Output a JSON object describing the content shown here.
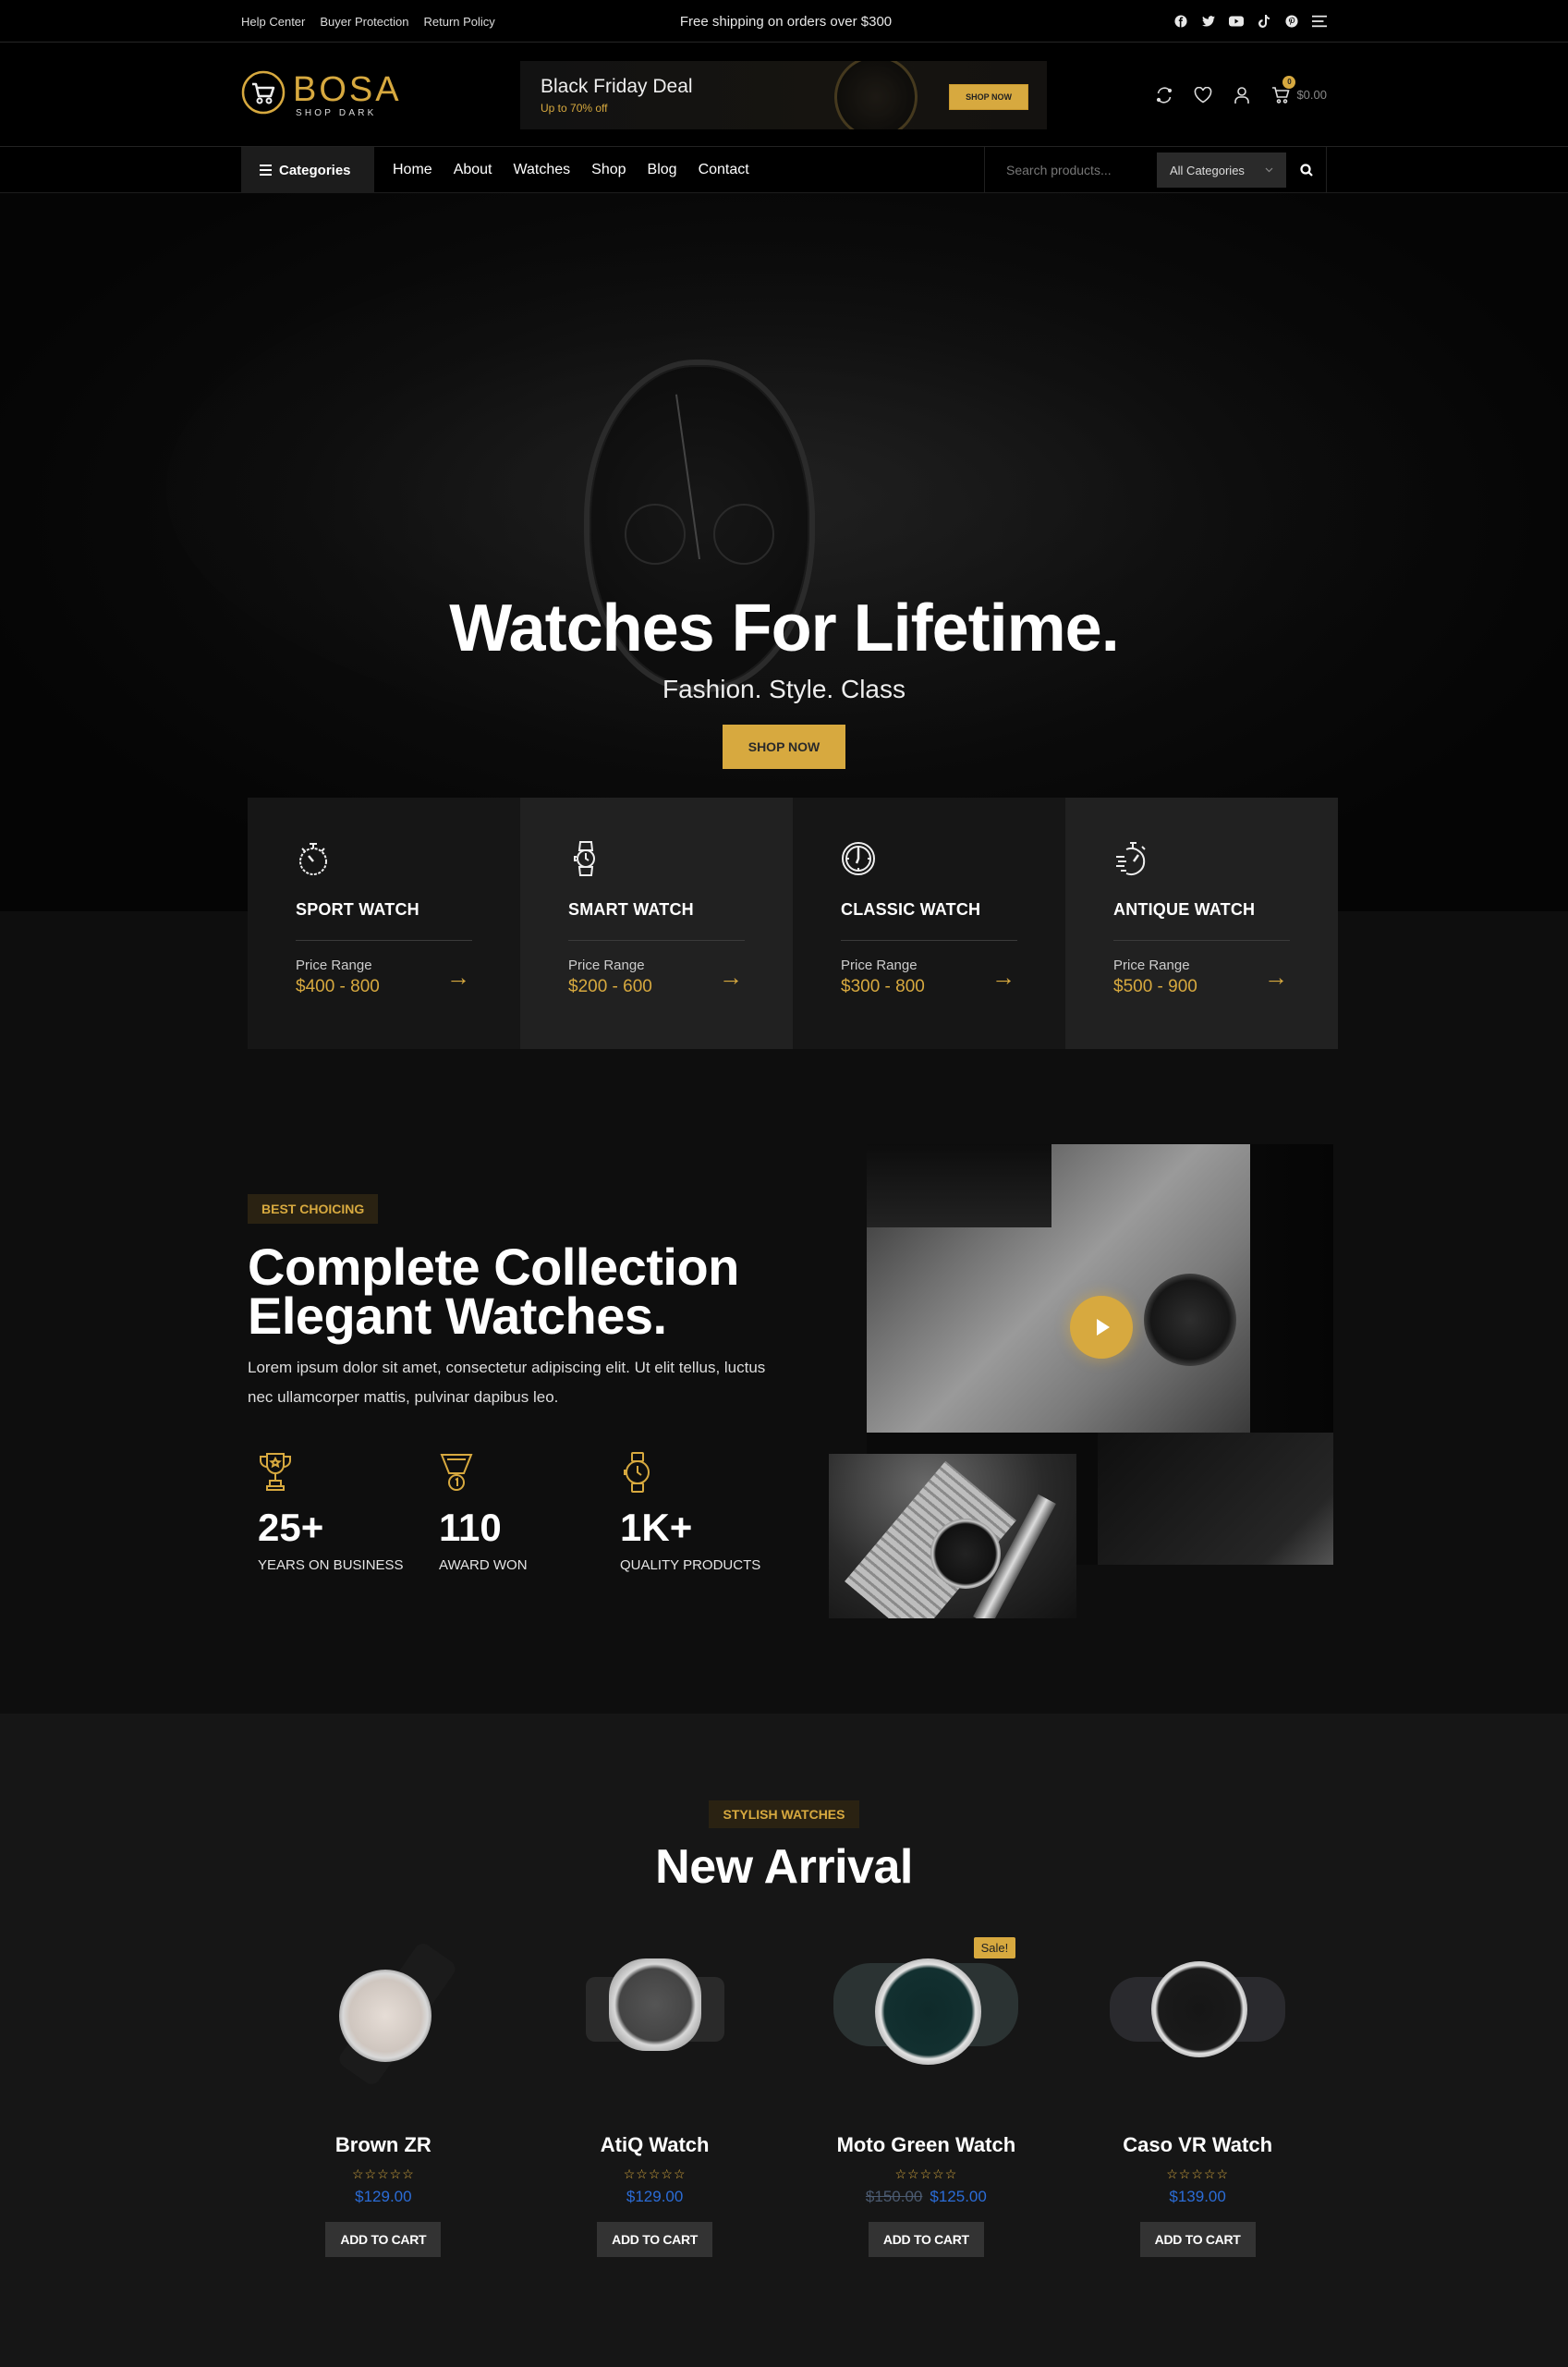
{
  "topbar": {
    "links": [
      "Help Center",
      "Buyer Protection",
      "Return Policy"
    ],
    "promo": "Free shipping on orders over $300",
    "social_icons": [
      "facebook-icon",
      "twitter-icon",
      "youtube-icon",
      "tiktok-icon",
      "pinterest-icon",
      "hamburger-menu-icon"
    ]
  },
  "header": {
    "logo_brand": "BOSA",
    "logo_sub": "SHOP DARK",
    "deal": {
      "title": "Black Friday Deal",
      "subtitle": "Up to 70% off",
      "button": "SHOP NOW"
    },
    "actions": [
      "compare-icon",
      "wishlist-icon",
      "account-icon",
      "cart-icon"
    ],
    "cart_count": "0",
    "cart_total": "$0.00"
  },
  "nav": {
    "categories_label": "Categories",
    "menu": [
      "Home",
      "About",
      "Watches",
      "Shop",
      "Blog",
      "Contact"
    ],
    "search_placeholder": "Search products...",
    "search_category": "All Categories"
  },
  "hero": {
    "title": "Watches For Lifetime.",
    "subtitle": "Fashion. Style. Class",
    "button": "SHOP NOW"
  },
  "categories": [
    {
      "name": "SPORT WATCH",
      "icon": "stopwatch-icon",
      "label": "Price Range",
      "price": "$400 - 800"
    },
    {
      "name": "SMART WATCH",
      "icon": "wristwatch-icon",
      "label": "Price Range",
      "price": "$200 - 600"
    },
    {
      "name": "CLASSIC WATCH",
      "icon": "clock-icon",
      "label": "Price Range",
      "price": "$300 - 800"
    },
    {
      "name": "ANTIQUE WATCH",
      "icon": "fast-stopwatch-icon",
      "label": "Price Range",
      "price": "$500 - 900"
    }
  ],
  "collection": {
    "tag": "BEST CHOICING",
    "title_line1": "Complete Collection",
    "title_line2": "Elegant Watches.",
    "text": "Lorem ipsum dolor sit amet, consectetur adipiscing elit. Ut elit tellus, luctus nec ullamcorper mattis, pulvinar dapibus leo.",
    "stats": [
      {
        "icon": "trophy-icon",
        "value": "25+",
        "label": "YEARS ON BUSINESS"
      },
      {
        "icon": "medal-icon",
        "value": "110",
        "label": "AWARD WON"
      },
      {
        "icon": "watch-icon",
        "value": "1K+",
        "label": "QUALITY PRODUCTS"
      }
    ]
  },
  "arrivals": {
    "tag": "STYLISH WATCHES",
    "title": "New Arrival",
    "products": [
      {
        "name": "Brown ZR",
        "rating": 0,
        "stars": "☆☆☆☆☆",
        "old_price": null,
        "price": "$129.00",
        "sale": null,
        "button": "ADD TO CART"
      },
      {
        "name": "AtiQ Watch",
        "rating": 0,
        "stars": "☆☆☆☆☆",
        "old_price": null,
        "price": "$129.00",
        "sale": null,
        "button": "ADD TO CART"
      },
      {
        "name": "Moto Green Watch",
        "rating": 0,
        "stars": "☆☆☆☆☆",
        "old_price": "$150.00",
        "price": "$125.00",
        "sale": "Sale!",
        "button": "ADD TO CART"
      },
      {
        "name": "Caso VR Watch",
        "rating": 0,
        "stars": "☆☆☆☆☆",
        "old_price": null,
        "price": "$139.00",
        "sale": null,
        "button": "ADD TO CART"
      }
    ]
  },
  "colors": {
    "accent": "#d7a93f",
    "price": "#2b6cd6",
    "background": "#0e0e0e"
  }
}
